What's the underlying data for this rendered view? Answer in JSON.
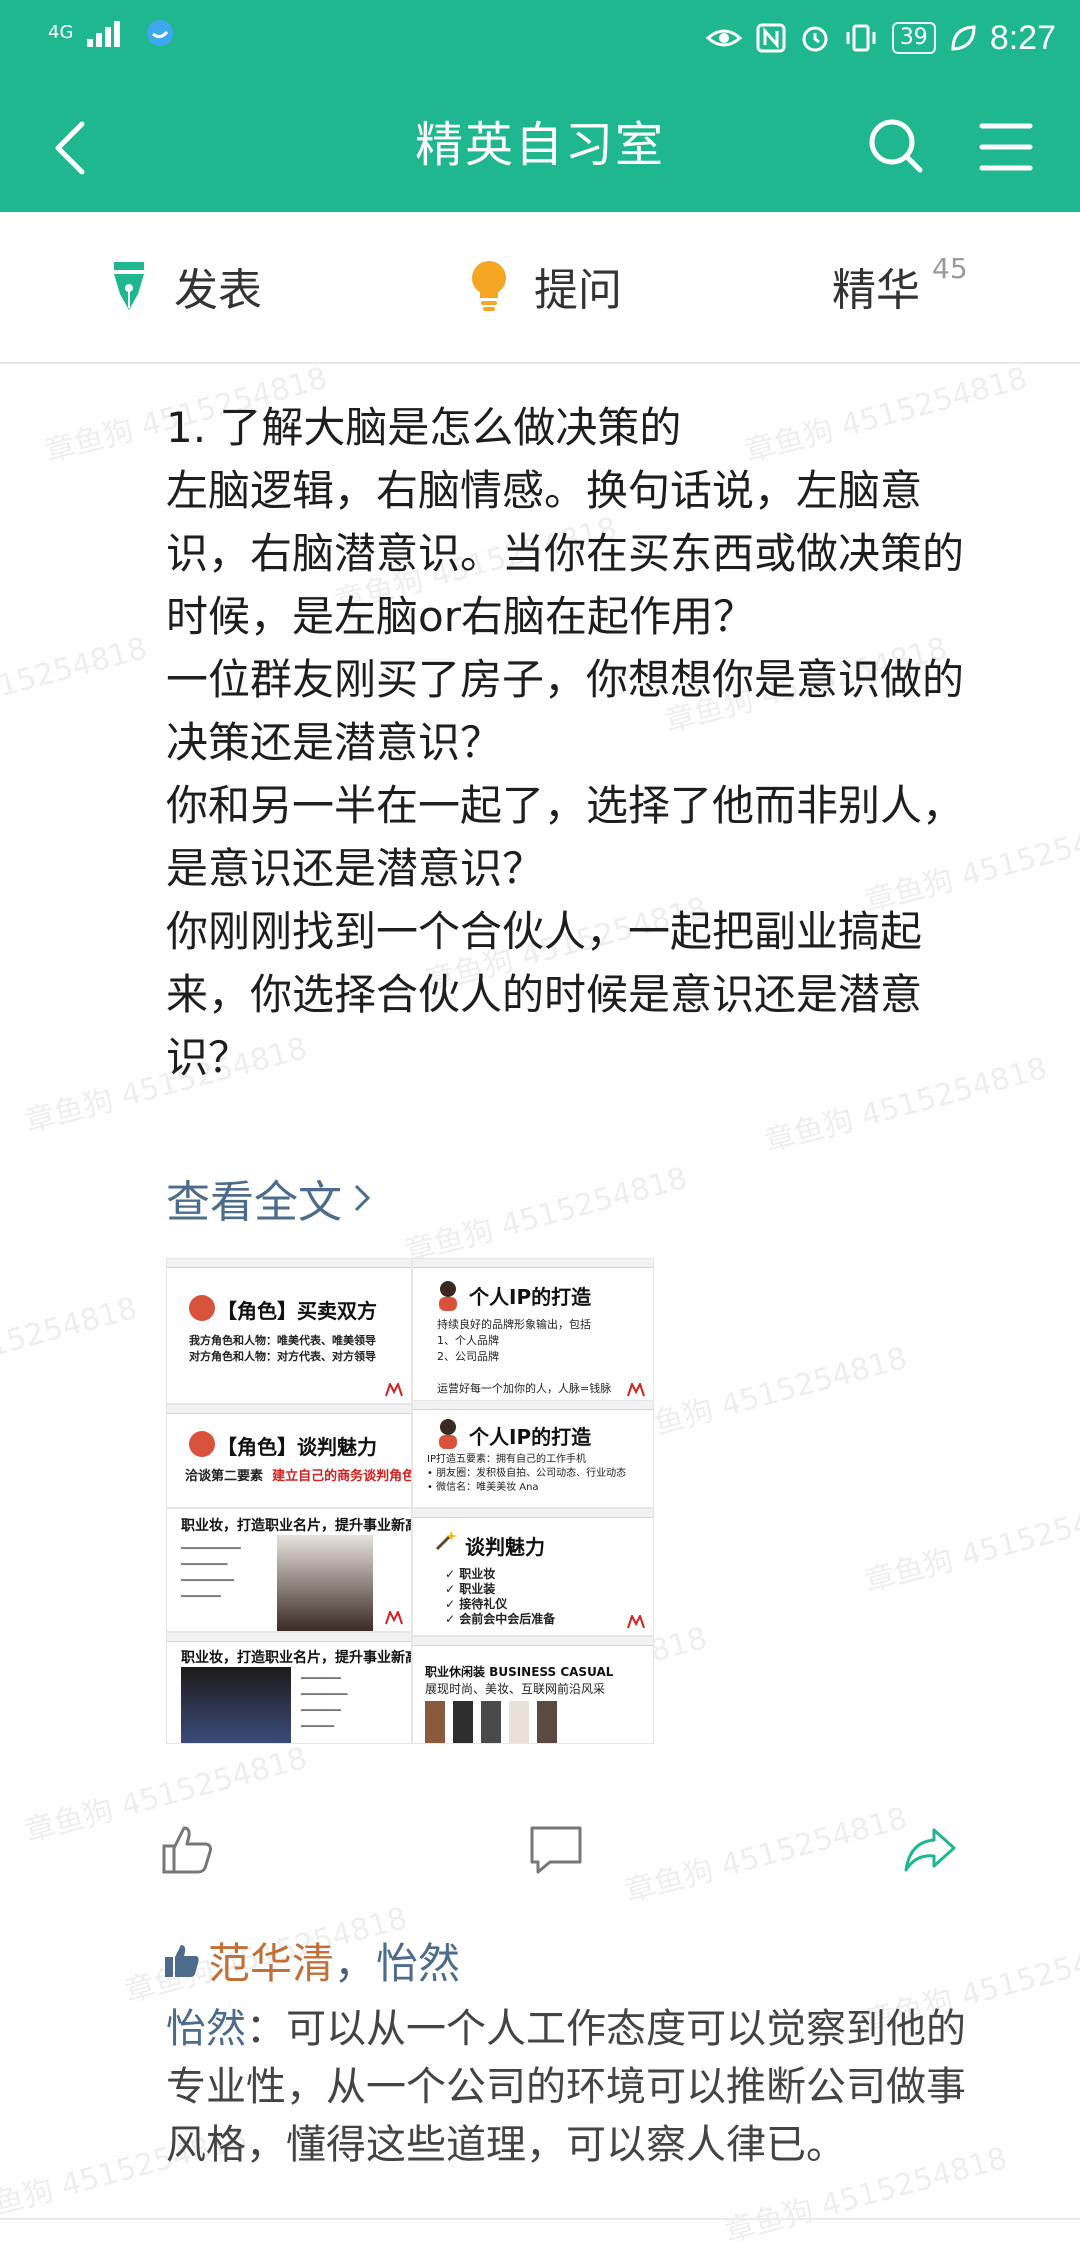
{
  "status_bar": {
    "network": "4G",
    "battery": "39",
    "time": "8:27"
  },
  "nav": {
    "title": "精英自习室"
  },
  "tabs": {
    "publish": "发表",
    "ask": "提问",
    "featured": "精华",
    "featured_count": "45"
  },
  "watermark": "章鱼狗 4515254818",
  "post": {
    "lines": [
      "1. 了解大脑是怎么做决策的",
      "左脑逻辑，右脑情感。换句话说，左脑意识，右脑潜意识。当你在买东西或做决策的时候，是左脑or右脑在起作用？",
      "一位群友刚买了房子，你想想你是意识做的决策还是潜意识？",
      "你和另一半在一起了，选择了他而非别人，是意识还是潜意识？",
      "你刚刚找到一个合伙人，一起把副业搞起来，你选择合伙人的时候是意识还是潜意识？"
    ],
    "read_more": "查看全文"
  },
  "slides": [
    {
      "title": "【角色】买卖双方",
      "text": "我方角色和人物：唯美代表、唯美领导\n对方角色和人物：对方代表、对方领导"
    },
    {
      "title": "个人IP的打造",
      "text": "持续良好的品牌形象输出，包括\n1、个人品牌\n2、公司品牌\n\n运营好每一个加你的人，人脉=钱脉"
    },
    {
      "title": "【角色】谈判魅力",
      "text": "洽谈第二要素",
      "highlight": "建立自己的商务谈判角色魅力"
    },
    {
      "title": "个人IP的打造",
      "text": "IP打造五要素：拥有自己的工作手机\n• 朋友圈：发积极自拍、公司动态、行业动态\n• 微信名：唯美美妆 Ana"
    },
    {
      "title": "职业妆，打造职业名片，提升事业新高度",
      "text": ""
    },
    {
      "title": "谈判魅力",
      "text": "✓ 职业妆\n✓ 职业装\n✓ 接待礼仪\n✓ 会前会中会后准备"
    },
    {
      "title": "职业妆，打造职业名片，提升事业新高度",
      "text": ""
    },
    {
      "title": "职业休闲装 BUSINESS CASUAL",
      "text": "展现时尚、美妆、互联网前沿风采"
    }
  ],
  "likes": {
    "names": [
      "范华清",
      "怡然"
    ],
    "separator": "，"
  },
  "comment": {
    "author": "怡然",
    "colon": "：",
    "text": "可以从一个人工作态度可以觉察到他的专业性，从一个公司的环境可以推断公司做事风格，懂得这些道理，可以察人律已。"
  },
  "colors": {
    "accent": "#1fb790",
    "link": "#4d6b8a",
    "like_name": "#c1703a",
    "tab_pen": "#1fb790",
    "tab_bulb": "#f5a623"
  }
}
